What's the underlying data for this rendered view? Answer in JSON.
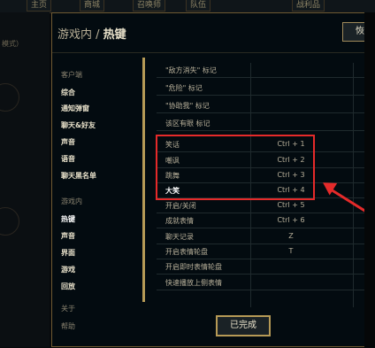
{
  "background": {
    "tabs": [
      "主页",
      "商城",
      "召唤师",
      "队伍",
      "战利品"
    ],
    "left_text": "模式）"
  },
  "modal": {
    "title_prefix": "游戏内",
    "title_sep": " / ",
    "title": "热键",
    "restore_button": "恢复"
  },
  "sidebar": {
    "groups": [
      {
        "label": "客户端",
        "items": [
          {
            "label": "综合"
          },
          {
            "label": "通知弹窗"
          },
          {
            "label": "聊天&好友"
          },
          {
            "label": "声音"
          },
          {
            "label": "语音"
          },
          {
            "label": "聊天黑名单"
          }
        ]
      },
      {
        "label": "游戏内",
        "items": [
          {
            "label": "热键",
            "active": true
          },
          {
            "label": "声音"
          },
          {
            "label": "界面"
          },
          {
            "label": "游戏"
          },
          {
            "label": "回放"
          }
        ]
      }
    ],
    "extra": [
      {
        "label": "关于"
      },
      {
        "label": "帮助"
      }
    ]
  },
  "hotkeys": {
    "rows": [
      {
        "name": "\"敌方消失\" 标记",
        "key": ""
      },
      {
        "name": "\"危险\" 标记",
        "key": ""
      },
      {
        "name": "\"协助我\" 标记",
        "key": ""
      },
      {
        "name": "该区有眼 标记",
        "key": ""
      },
      {
        "name": "笑话",
        "key": "Ctrl + 1"
      },
      {
        "name": "嘲讽",
        "key": "Ctrl + 2"
      },
      {
        "name": "跳舞",
        "key": "Ctrl + 3"
      },
      {
        "name": "大笑",
        "key": "Ctrl + 4",
        "bold": true
      },
      {
        "name": "开启/关闭",
        "key": "Ctrl + 5"
      },
      {
        "name": "成就表情",
        "key": "Ctrl + 6"
      },
      {
        "name": "聊天记录",
        "key": "Z"
      },
      {
        "name": "开启表情轮盘",
        "key": "T"
      },
      {
        "name": "开启即时表情轮盘",
        "key": ""
      },
      {
        "name": "快速播放上侧表情",
        "key": ""
      }
    ]
  },
  "footer": {
    "done_button": "已完成"
  },
  "colors": {
    "accent_gold": "#b69a56",
    "annotation_red": "#e52a2a"
  }
}
